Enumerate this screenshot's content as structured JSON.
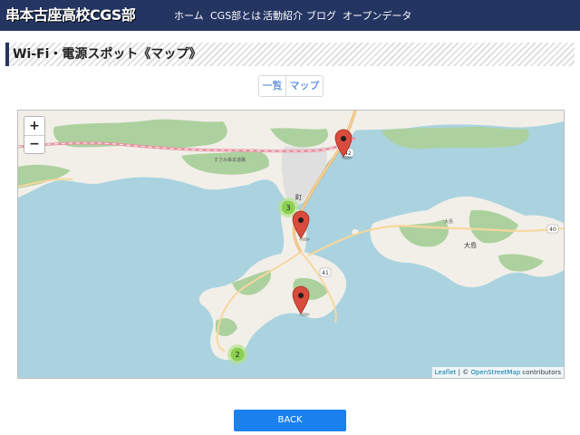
{
  "header": {
    "brand": "串本古座高校CGS部",
    "nav": [
      {
        "label": "ホーム"
      },
      {
        "label": "CGS部とは"
      },
      {
        "label": "活動紹介"
      },
      {
        "label": "ブログ"
      },
      {
        "label": "オープンデータ"
      }
    ]
  },
  "page": {
    "title": "Wi-Fi・電源スポット《マップ》",
    "view_toggle": {
      "list_label": "一覧",
      "map_label": "マップ"
    }
  },
  "map": {
    "zoom_in_label": "+",
    "zoom_out_label": "−",
    "clusters": [
      {
        "count": "3",
        "color": "#8cd050"
      },
      {
        "count": "2",
        "color": "#8cd050"
      }
    ],
    "markers": [
      {
        "icon": "map-pin-icon",
        "color": "#d94c3d"
      },
      {
        "icon": "map-pin-icon",
        "color": "#d94c3d"
      },
      {
        "icon": "map-pin-icon",
        "color": "#d94c3d"
      }
    ],
    "labels": {
      "route_42": "42",
      "route_41": "41",
      "route_40": "40",
      "place_oshima": "大島",
      "place_oshima_small": "大島",
      "town": "町",
      "expressway": "すさみ串本道路"
    },
    "attribution": {
      "leaflet": "Leaflet",
      "separator": " | © ",
      "osm": "OpenStreetMap",
      "suffix": " contributors"
    },
    "colors": {
      "sea": "#aad3df",
      "land": "#f2efe9",
      "forest": "#add19e",
      "urban": "#e0dfdf",
      "road": "#f7d79e",
      "road_edge": "#e7a95a",
      "route": "#e892a2"
    }
  },
  "footer": {
    "back_label": "BACK"
  }
}
